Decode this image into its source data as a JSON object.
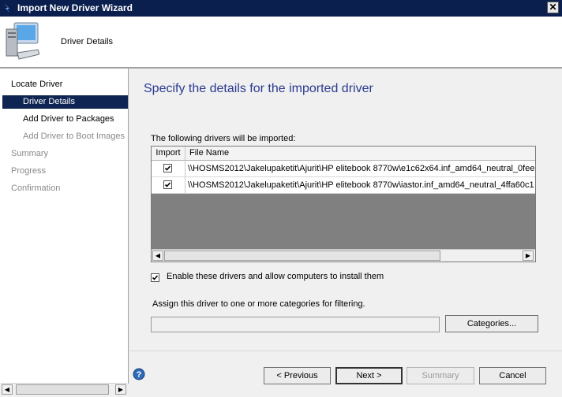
{
  "window": {
    "title": "Import New Driver Wizard",
    "close_glyph": "✕"
  },
  "header": {
    "title": "Driver Details",
    "icon": "computer-monitor-icon"
  },
  "sidebar": {
    "items": [
      {
        "label": "Locate Driver",
        "state": "normal"
      },
      {
        "label": "Driver Details",
        "state": "selected"
      },
      {
        "label": "Add Driver to Packages",
        "state": "normal"
      },
      {
        "label": "Add Driver to Boot Images",
        "state": "disabled"
      },
      {
        "label": "Summary",
        "state": "disabled"
      },
      {
        "label": "Progress",
        "state": "disabled"
      },
      {
        "label": "Confirmation",
        "state": "disabled"
      }
    ]
  },
  "main": {
    "title": "Specify the details for the imported driver",
    "list_label": "The following drivers will be imported:",
    "columns": [
      "Import",
      "File Name"
    ],
    "rows": [
      {
        "checked": true,
        "file": "\\\\HOSMS2012\\Jakelupaketit\\Ajurit\\HP elitebook 8770w\\e1c62x64.inf_amd64_neutral_0fee"
      },
      {
        "checked": true,
        "file": "\\\\HOSMS2012\\Jakelupaketit\\Ajurit\\HP elitebook 8770w\\iastor.inf_amd64_neutral_4ffa60c1"
      }
    ],
    "enable_checked": true,
    "enable_label": "Enable these drivers and allow computers to install them",
    "assign_label": "Assign this driver to one or more categories for filtering.",
    "categories_value": "",
    "categories_button": "Categories..."
  },
  "footer": {
    "previous": "< Previous",
    "next": "Next >",
    "summary": "Summary",
    "cancel": "Cancel",
    "help_glyph": "?"
  },
  "colors": {
    "accent": "#0e2452",
    "title_text": "#2a3a90"
  }
}
